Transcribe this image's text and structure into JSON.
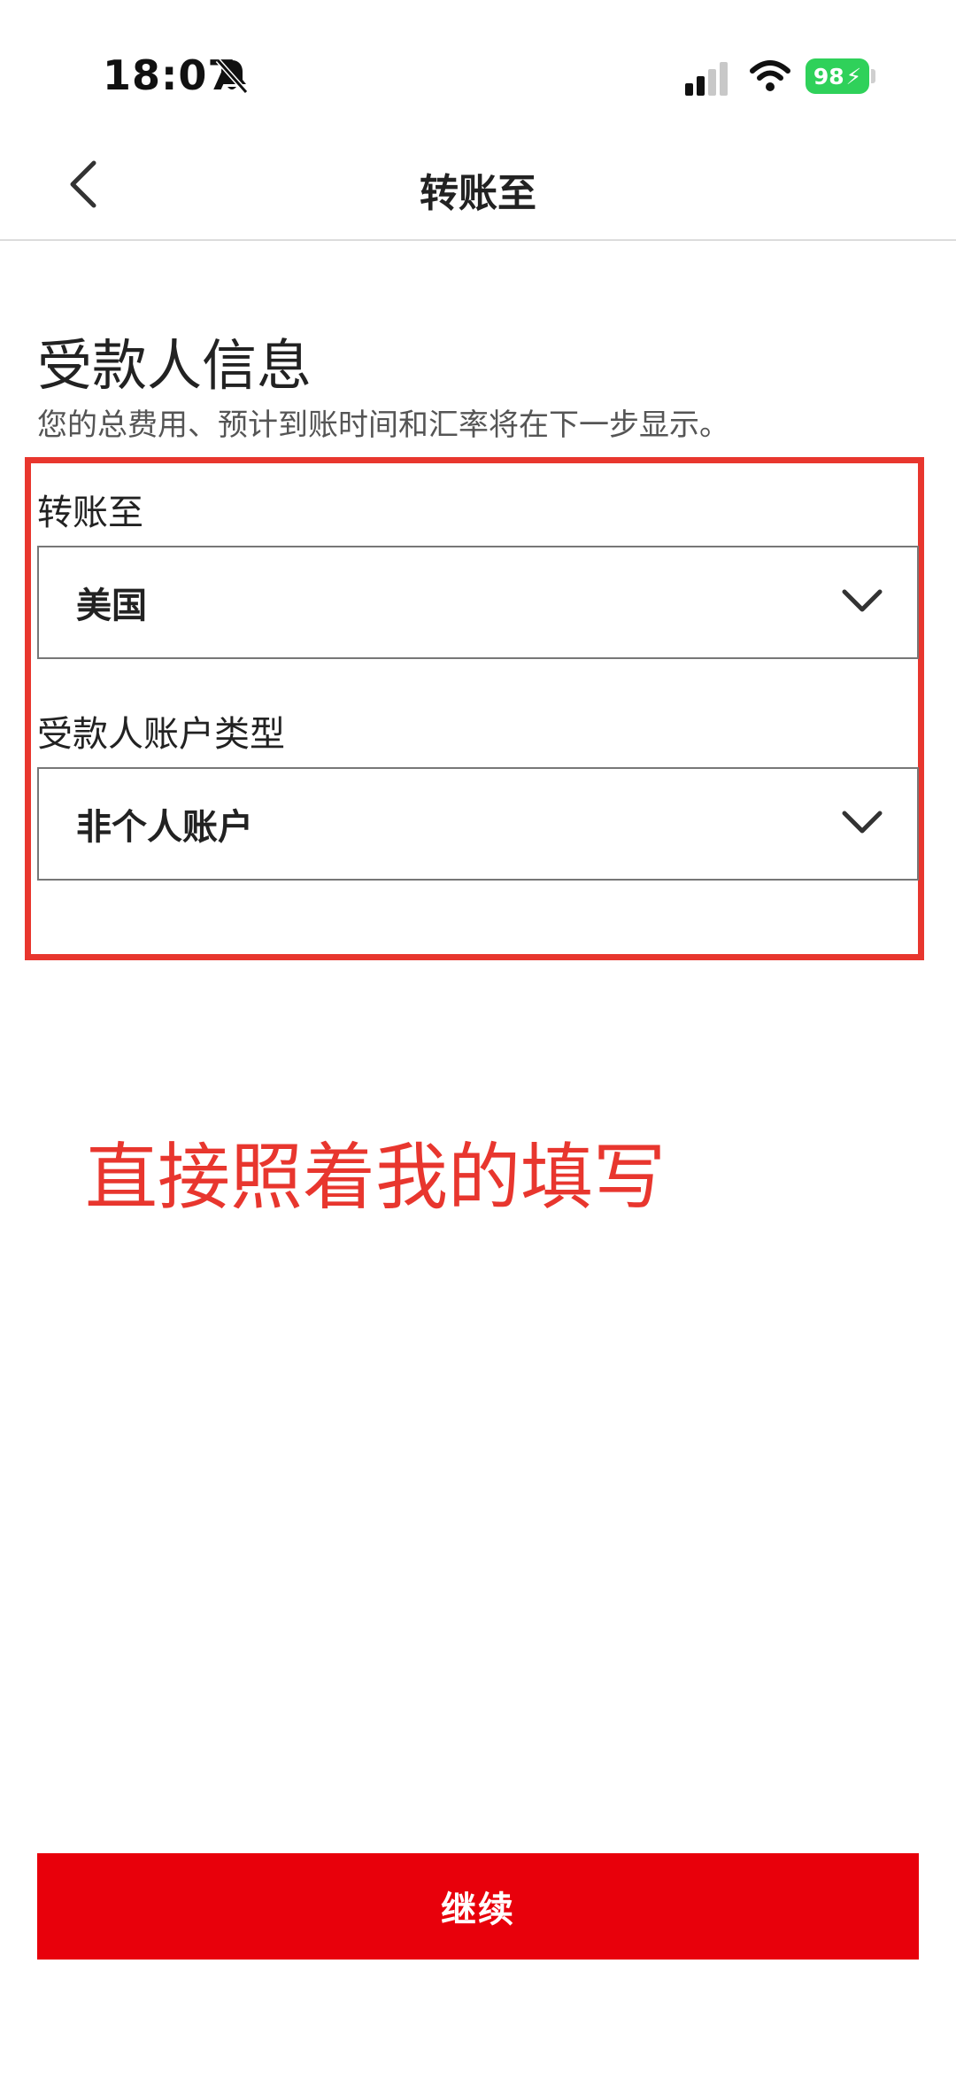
{
  "status_bar": {
    "time": "18:07",
    "battery": "98",
    "icons": [
      "bell-slash-icon",
      "signal-icon",
      "wifi-icon",
      "battery-charging-icon"
    ]
  },
  "nav": {
    "back_icon": "chevron-left-icon",
    "title": "转账至"
  },
  "section": {
    "title": "受款人信息",
    "subtitle": "您的总费用、预计到账时间和汇率将在下一步显示。"
  },
  "form": {
    "destination_label": "转账至",
    "destination_value": "美国",
    "account_type_label": "受款人账户类型",
    "account_type_value": "非个人账户",
    "dropdown_icon": "chevron-down-icon"
  },
  "annotation": "直接照着我的填写",
  "continue_button": "继续",
  "colors": {
    "accent": "#e8000b",
    "annotation": "#e8362e",
    "battery": "#2fd15a"
  }
}
